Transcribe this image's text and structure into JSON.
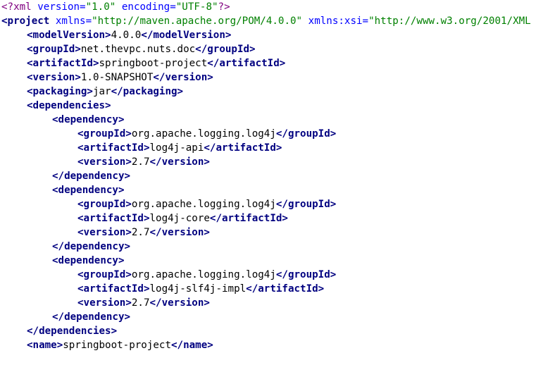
{
  "colors": {
    "background": "#ffffff",
    "tag": "#000080",
    "attr_name": "#0000ff",
    "attr_value": "#008000",
    "processing_instruction": "#800080",
    "text": "#000000"
  },
  "lines": [
    {
      "indent": 0,
      "parts": [
        {
          "k": "pi",
          "t": "<?xml "
        },
        {
          "k": "attr",
          "t": "version="
        },
        {
          "k": "val",
          "t": "\"1.0\""
        },
        {
          "k": "txt",
          "t": " "
        },
        {
          "k": "attr",
          "t": "encoding="
        },
        {
          "k": "val",
          "t": "\"UTF-8\""
        },
        {
          "k": "pi",
          "t": "?>"
        }
      ]
    },
    {
      "indent": 0,
      "parts": [
        {
          "k": "tag",
          "t": "<project"
        },
        {
          "k": "txt",
          "t": " "
        },
        {
          "k": "attr",
          "t": "xmlns="
        },
        {
          "k": "val",
          "t": "\"http://maven.apache.org/POM/4.0.0\""
        },
        {
          "k": "txt",
          "t": " "
        },
        {
          "k": "attr",
          "t": "xmlns:xsi="
        },
        {
          "k": "val",
          "t": "\"http://www.w3.org/2001/XML"
        }
      ]
    },
    {
      "indent": 1,
      "parts": [
        {
          "k": "tag",
          "t": "<modelVersion>"
        },
        {
          "k": "txt",
          "t": "4.0.0"
        },
        {
          "k": "tag",
          "t": "</modelVersion>"
        }
      ]
    },
    {
      "indent": 1,
      "parts": [
        {
          "k": "tag",
          "t": "<groupId>"
        },
        {
          "k": "txt",
          "t": "net.thevpc.nuts.doc"
        },
        {
          "k": "tag",
          "t": "</groupId>"
        }
      ]
    },
    {
      "indent": 1,
      "parts": [
        {
          "k": "tag",
          "t": "<artifactId>"
        },
        {
          "k": "txt",
          "t": "springboot-project"
        },
        {
          "k": "tag",
          "t": "</artifactId>"
        }
      ]
    },
    {
      "indent": 1,
      "parts": [
        {
          "k": "tag",
          "t": "<version>"
        },
        {
          "k": "txt",
          "t": "1.0-SNAPSHOT"
        },
        {
          "k": "tag",
          "t": "</version>"
        }
      ]
    },
    {
      "indent": 1,
      "parts": [
        {
          "k": "tag",
          "t": "<packaging>"
        },
        {
          "k": "txt",
          "t": "jar"
        },
        {
          "k": "tag",
          "t": "</packaging>"
        }
      ]
    },
    {
      "indent": 1,
      "parts": [
        {
          "k": "tag",
          "t": "<dependencies>"
        }
      ]
    },
    {
      "indent": 2,
      "parts": [
        {
          "k": "tag",
          "t": "<dependency>"
        }
      ]
    },
    {
      "indent": 3,
      "parts": [
        {
          "k": "tag",
          "t": "<groupId>"
        },
        {
          "k": "txt",
          "t": "org.apache.logging.log4j"
        },
        {
          "k": "tag",
          "t": "</groupId>"
        }
      ]
    },
    {
      "indent": 3,
      "parts": [
        {
          "k": "tag",
          "t": "<artifactId>"
        },
        {
          "k": "txt",
          "t": "log4j-api"
        },
        {
          "k": "tag",
          "t": "</artifactId>"
        }
      ]
    },
    {
      "indent": 3,
      "parts": [
        {
          "k": "tag",
          "t": "<version>"
        },
        {
          "k": "txt",
          "t": "2.7"
        },
        {
          "k": "tag",
          "t": "</version>"
        }
      ]
    },
    {
      "indent": 2,
      "parts": [
        {
          "k": "tag",
          "t": "</dependency>"
        }
      ]
    },
    {
      "indent": 2,
      "parts": [
        {
          "k": "tag",
          "t": "<dependency>"
        }
      ]
    },
    {
      "indent": 3,
      "parts": [
        {
          "k": "tag",
          "t": "<groupId>"
        },
        {
          "k": "txt",
          "t": "org.apache.logging.log4j"
        },
        {
          "k": "tag",
          "t": "</groupId>"
        }
      ]
    },
    {
      "indent": 3,
      "parts": [
        {
          "k": "tag",
          "t": "<artifactId>"
        },
        {
          "k": "txt",
          "t": "log4j-core"
        },
        {
          "k": "tag",
          "t": "</artifactId>"
        }
      ]
    },
    {
      "indent": 3,
      "parts": [
        {
          "k": "tag",
          "t": "<version>"
        },
        {
          "k": "txt",
          "t": "2.7"
        },
        {
          "k": "tag",
          "t": "</version>"
        }
      ]
    },
    {
      "indent": 2,
      "parts": [
        {
          "k": "tag",
          "t": "</dependency>"
        }
      ]
    },
    {
      "indent": 2,
      "parts": [
        {
          "k": "tag",
          "t": "<dependency>"
        }
      ]
    },
    {
      "indent": 3,
      "parts": [
        {
          "k": "tag",
          "t": "<groupId>"
        },
        {
          "k": "txt",
          "t": "org.apache.logging.log4j"
        },
        {
          "k": "tag",
          "t": "</groupId>"
        }
      ]
    },
    {
      "indent": 3,
      "parts": [
        {
          "k": "tag",
          "t": "<artifactId>"
        },
        {
          "k": "txt",
          "t": "log4j-slf4j-impl"
        },
        {
          "k": "tag",
          "t": "</artifactId>"
        }
      ]
    },
    {
      "indent": 3,
      "parts": [
        {
          "k": "tag",
          "t": "<version>"
        },
        {
          "k": "txt",
          "t": "2.7"
        },
        {
          "k": "tag",
          "t": "</version>"
        }
      ]
    },
    {
      "indent": 2,
      "parts": [
        {
          "k": "tag",
          "t": "</dependency>"
        }
      ]
    },
    {
      "indent": 1,
      "parts": [
        {
          "k": "tag",
          "t": "</dependencies>"
        }
      ]
    },
    {
      "indent": 1,
      "parts": [
        {
          "k": "tag",
          "t": "<name>"
        },
        {
          "k": "txt",
          "t": "springboot-project"
        },
        {
          "k": "tag",
          "t": "</name>"
        }
      ]
    }
  ]
}
